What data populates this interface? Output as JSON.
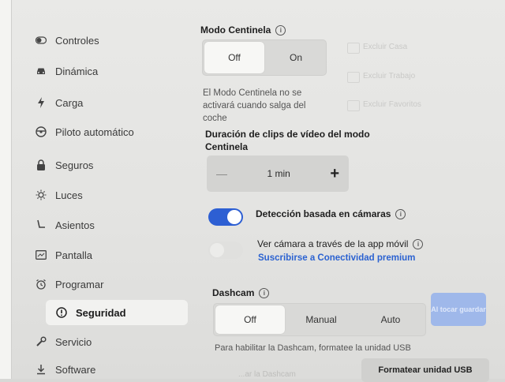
{
  "sidebar": {
    "items": [
      {
        "label": "Controles",
        "icon": "toggle-icon"
      },
      {
        "label": "Dinámica",
        "icon": "car-icon"
      },
      {
        "label": "Carga",
        "icon": "lightning-icon"
      },
      {
        "label": "Piloto automático",
        "icon": "steering-wheel-icon"
      },
      {
        "label": "Seguros",
        "icon": "lock-icon"
      },
      {
        "label": "Luces",
        "icon": "light-icon"
      },
      {
        "label": "Asientos",
        "icon": "seat-icon"
      },
      {
        "label": "Pantalla",
        "icon": "display-icon"
      },
      {
        "label": "Programar",
        "icon": "alarm-clock-icon"
      },
      {
        "label": "Seguridad",
        "icon": "alert-circle-icon",
        "active": true
      },
      {
        "label": "Servicio",
        "icon": "wrench-icon"
      },
      {
        "label": "Software",
        "icon": "download-icon"
      }
    ]
  },
  "sentry": {
    "title": "Modo Centinela",
    "options": [
      "Off",
      "On"
    ],
    "selected": "Off",
    "note": "El Modo Centinela no se activará cuando salga del coche",
    "excludes": [
      "Excluir Casa",
      "Excluir Trabajo",
      "Excluir Favoritos"
    ]
  },
  "clips": {
    "title": "Duración de clips de vídeo del modo Centinela",
    "value": "1 min",
    "minus": "—",
    "plus": "+"
  },
  "camera_detection": {
    "label": "Detección basada en cámaras",
    "on": true
  },
  "app_view": {
    "label": "Ver cámara a través de la app móvil",
    "link": "Suscribirse a Conectividad premium",
    "on": false
  },
  "dashcam": {
    "title": "Dashcam",
    "options": [
      "Off",
      "Manual",
      "Auto"
    ],
    "selected": "Off",
    "save_button": "Al tocar guardar",
    "note": "Para habilitar la Dashcam, formatee la unidad USB",
    "format_button": "Formatear unidad USB",
    "faded_left": "...ar la Dashcam"
  },
  "colors": {
    "accent": "#2d5fd3",
    "link": "#2b62d1"
  }
}
